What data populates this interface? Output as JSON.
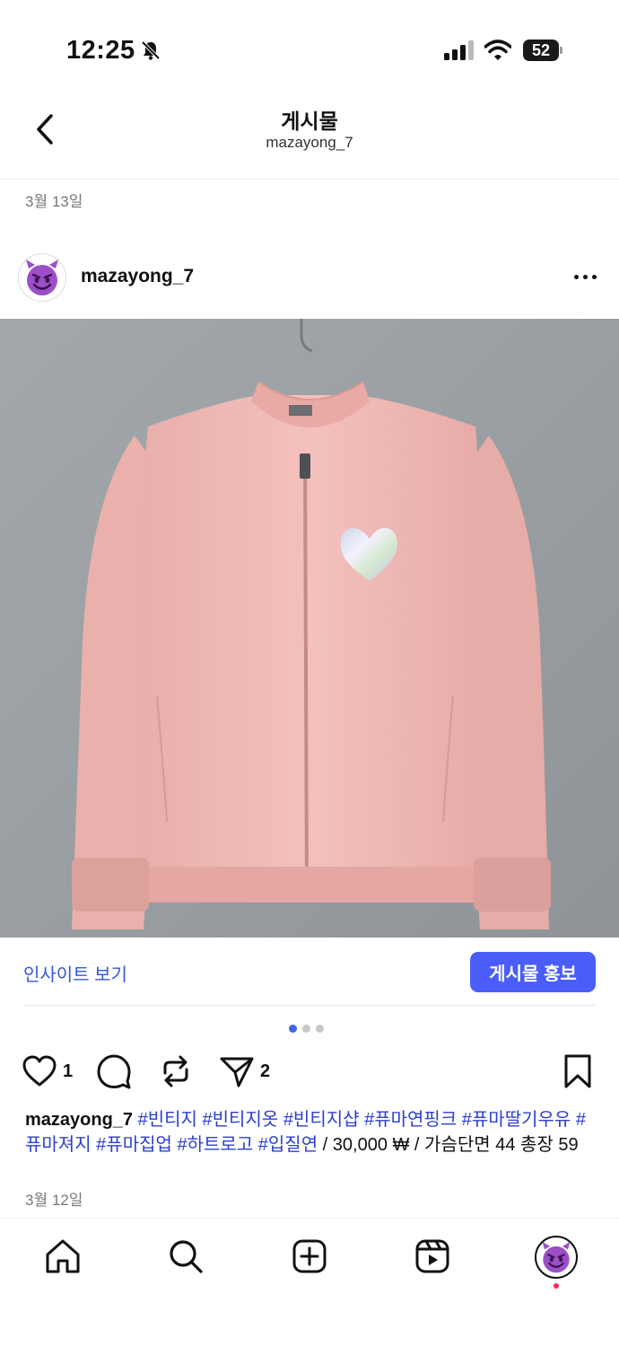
{
  "status_bar": {
    "time": "12:25",
    "battery": "52",
    "icons": [
      "bell-slash-icon",
      "signal-icon",
      "wifi-icon",
      "battery-icon"
    ]
  },
  "header": {
    "title": "게시물",
    "subtitle": "mazayong_7",
    "back_icon": "chevron-left-icon"
  },
  "post": {
    "date_top": "3월 13일",
    "username": "mazayong_7",
    "avatar_icon": "smiling-devil-emoji",
    "more_icon": "ellipsis-icon",
    "image_description_icon": "pink-track-jacket-photo",
    "insights_label": "인사이트 보기",
    "promote_label": "게시물 홍보",
    "carousel": {
      "count": 3,
      "active_index": 0
    },
    "like_count": "1",
    "share_count": "2",
    "caption": {
      "username": "mazayong_7",
      "tags": [
        "#빈티지",
        "#빈티지옷",
        "#빈티지샵",
        "#퓨마연핑크",
        "#퓨마딸기우유",
        "#퓨마져지",
        "#퓨마집업",
        "#하트로고",
        "#입질연"
      ],
      "text": " / 30,000 ₩ / 가슴단면 44 총장 59"
    },
    "date_bottom": "3월 12일"
  },
  "colors": {
    "accent": "#4a5df9",
    "link": "#3556d8",
    "hashtag": "#2c3fd0",
    "carousel_active": "#3f67e8",
    "notification_dot": "#ff2d55",
    "jacket": "#f0b8b4",
    "wall": "#9fa4a8"
  },
  "nav": {
    "items": [
      "home-icon",
      "search-icon",
      "create-icon",
      "reels-icon",
      "profile-avatar"
    ]
  }
}
